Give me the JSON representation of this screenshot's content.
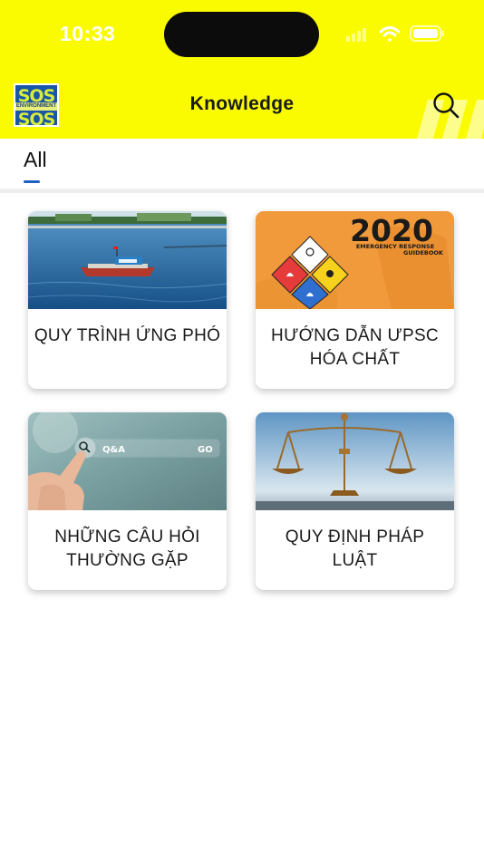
{
  "status_bar": {
    "time": "10:33"
  },
  "header": {
    "logo_text_top": "SOS",
    "logo_text_band": "ENVIRONMENT",
    "logo_text_bottom": "SOS",
    "title": "Knowledge",
    "accent_color": "#fbfb00"
  },
  "tabs": [
    {
      "label": "All",
      "selected": true
    }
  ],
  "cards": [
    {
      "title": "QUY TRÌNH ỨNG PHÓ",
      "image": "boat-on-sea"
    },
    {
      "title": "HƯỚNG DẪN ƯPSC HÓA CHẤT",
      "image": "emergency-guidebook-cover",
      "image_texts": {
        "year": "2020",
        "line1": "EMERGENCY RESPONSE",
        "line2": "GUIDEBOOK"
      }
    },
    {
      "title": "NHỮNG CÂU HỎI THƯỜNG GẶP",
      "image": "finger-touching-search-bar",
      "image_texts": {
        "search": "Q&A",
        "go": "GO"
      }
    },
    {
      "title": "QUY ĐỊNH PHÁP LUẬT",
      "image": "scales-of-justice"
    }
  ]
}
